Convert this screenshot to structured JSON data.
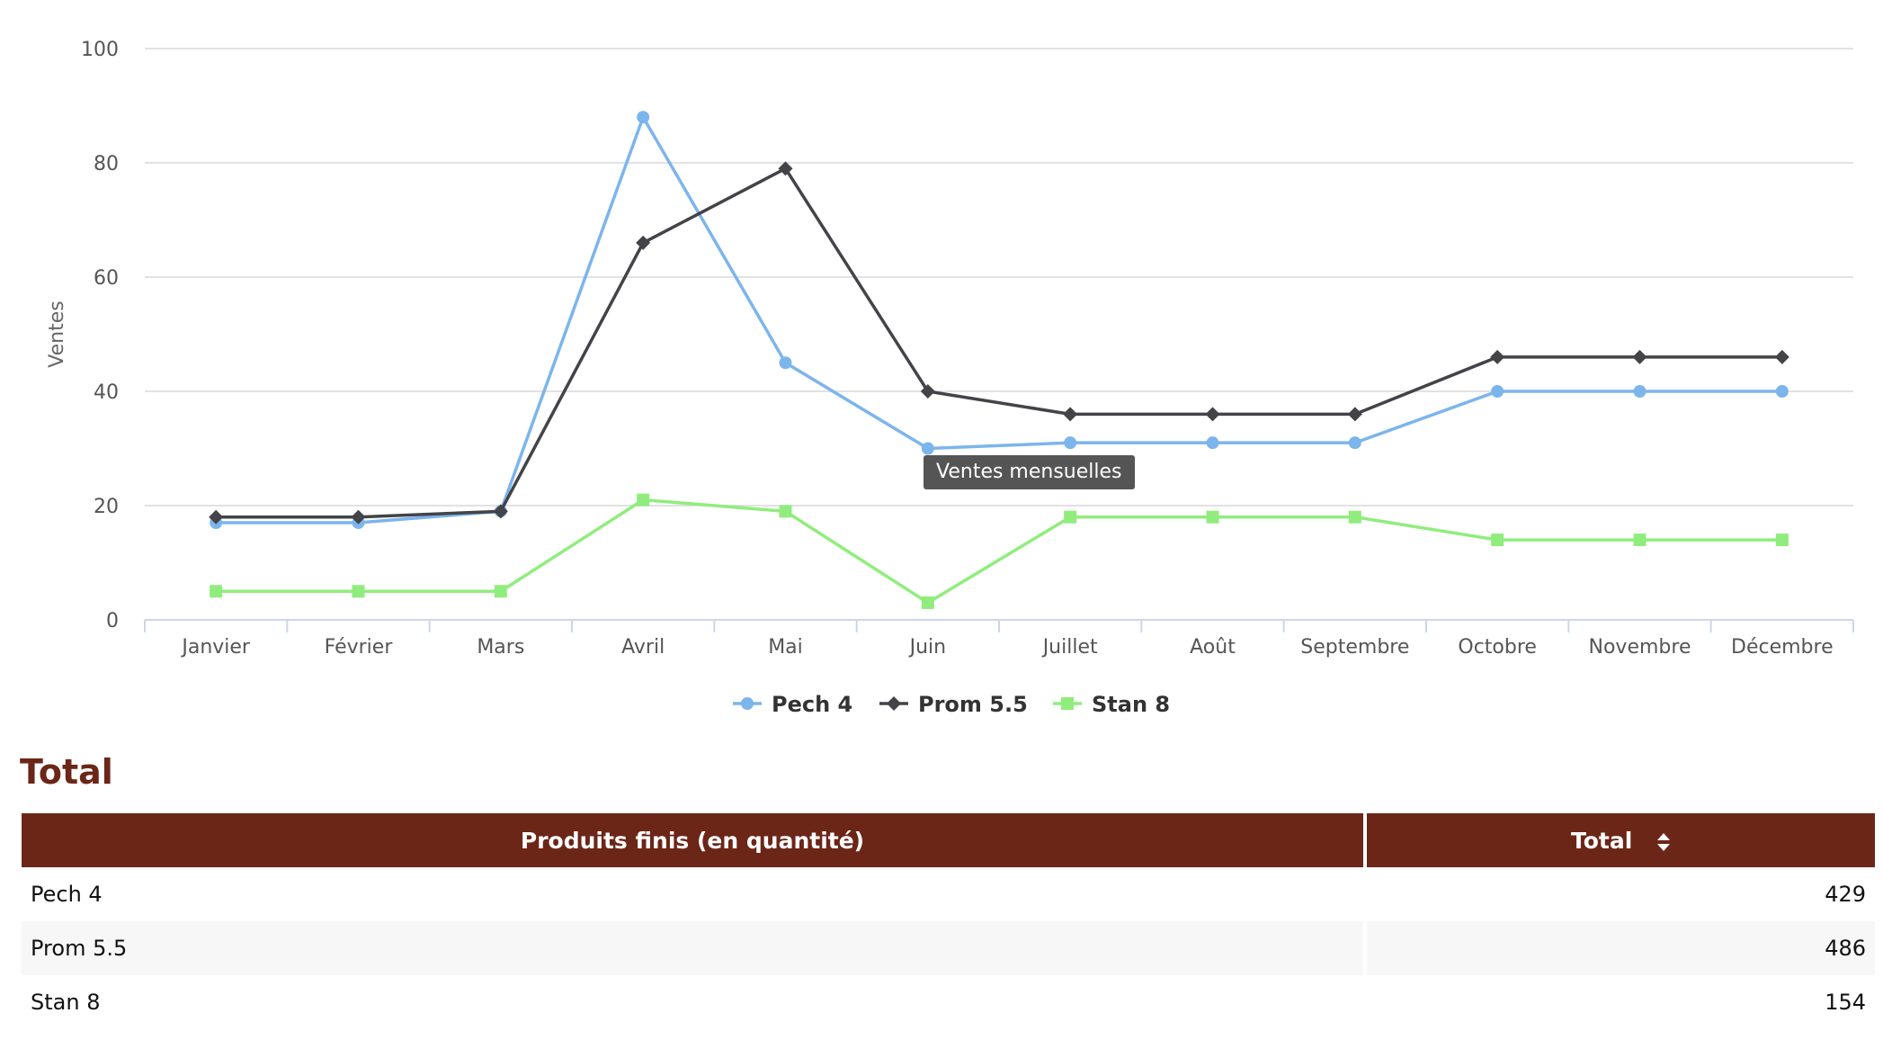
{
  "chart_data": {
    "type": "line",
    "title": "",
    "xlabel": "",
    "ylabel": "Ventes",
    "ylim": [
      0,
      100
    ],
    "yticks": [
      0,
      20,
      40,
      60,
      80,
      100
    ],
    "grid": true,
    "legend_position": "bottom",
    "categories": [
      "Janvier",
      "Février",
      "Mars",
      "Avril",
      "Mai",
      "Juin",
      "Juillet",
      "Août",
      "Septembre",
      "Octobre",
      "Novembre",
      "Décembre"
    ],
    "series": [
      {
        "name": "Pech 4",
        "color": "#7cb5ec",
        "marker": "circle",
        "values": [
          17,
          17,
          19,
          88,
          45,
          30,
          31,
          31,
          31,
          40,
          40,
          40
        ]
      },
      {
        "name": "Prom 5.5",
        "color": "#434348",
        "marker": "diamond",
        "values": [
          18,
          18,
          19,
          66,
          79,
          40,
          36,
          36,
          36,
          46,
          46,
          46
        ]
      },
      {
        "name": "Stan 8",
        "color": "#90ed7d",
        "marker": "square",
        "values": [
          5,
          5,
          5,
          21,
          19,
          3,
          18,
          18,
          18,
          14,
          14,
          14
        ]
      }
    ]
  },
  "tooltip": {
    "text": "Ventes mensuelles"
  },
  "section": {
    "title": "Total"
  },
  "table": {
    "headers": [
      "Produits finis (en quantité)",
      "Total"
    ],
    "sort_icon": "sort-arrows-icon",
    "header_color": "#6b2618",
    "rows": [
      {
        "product": "Pech 4",
        "total": "429"
      },
      {
        "product": "Prom 5.5",
        "total": "486"
      },
      {
        "product": "Stan 8",
        "total": "154"
      }
    ]
  }
}
